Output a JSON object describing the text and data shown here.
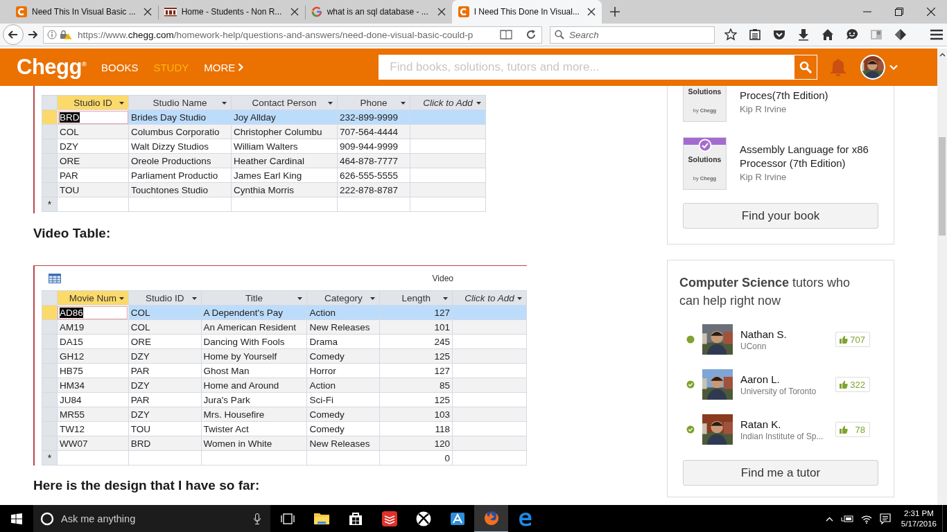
{
  "browser": {
    "tabs": [
      {
        "kind": "chegg",
        "title": "Need This In Visual Basic ...",
        "selected": false
      },
      {
        "kind": "iwu",
        "title": "Home - Students - Non R...",
        "selected": false
      },
      {
        "kind": "google",
        "title": "what is an sql database - ...",
        "selected": false
      },
      {
        "kind": "chegg",
        "title": "I Need This Done In Visual...",
        "selected": true
      }
    ],
    "url": {
      "scheme": "https://www.",
      "domain": "chegg.com",
      "path": "/homework-help/questions-and-answers/need-done-visual-basic-could-p"
    },
    "search": {
      "placeholder": "Search"
    }
  },
  "site_header": {
    "logo": "Chegg$^{®}$",
    "nav": [
      {
        "label": "BOOKS",
        "selected": false,
        "kind": "link"
      },
      {
        "label": "STUDY",
        "selected": true,
        "kind": "link"
      },
      {
        "label": "MORE",
        "selected": false,
        "kind": "menu"
      }
    ],
    "search": {
      "placeholder": "Find books, solutions, tutors and more..."
    }
  },
  "article": {
    "blocks": [
      {
        "kind": "table",
        "columns": [
          {
            "label": "Studio ID",
            "selected": true,
            "kind": "field"
          },
          {
            "label": "Studio Name",
            "selected": false,
            "kind": "field"
          },
          {
            "label": "Contact Person",
            "selected": false,
            "kind": "field"
          },
          {
            "label": "Phone",
            "selected": false,
            "kind": "field"
          },
          {
            "label": "Click to Add",
            "selected": false,
            "kind": "add"
          }
        ],
        "rows": [
          {
            "cells": [
              "BRD",
              "Brides Day Studio",
              "Joy Allday",
              "232-899-9999"
            ],
            "selected": true
          },
          {
            "cells": [
              "COL",
              "Columbus Corporatio",
              "Christopher Columbu",
              "707-564-4444"
            ],
            "selected": false
          },
          {
            "cells": [
              "DZY",
              "Walt Dizzy Studios",
              "William Walters",
              "909-944-9999"
            ],
            "selected": false
          },
          {
            "cells": [
              "ORE",
              "Oreole Productions",
              "Heather Cardinal",
              "464-878-7777"
            ],
            "selected": false
          },
          {
            "cells": [
              "PAR",
              "Parliament Productio",
              "James Earl King",
              "626-555-5555"
            ],
            "selected": false
          },
          {
            "cells": [
              "TOU",
              "Touchtones Studio",
              "Cynthia Morris",
              "222-878-8787"
            ],
            "selected": false
          },
          {
            "cells": [
              null,
              null,
              null,
              null
            ],
            "selected": false,
            "marker": "*"
          }
        ]
      },
      {
        "kind": "heading",
        "text": "Video Table:"
      },
      {
        "kind": "table",
        "caption": "Video",
        "columns": [
          {
            "label": "Movie Num",
            "selected": true,
            "kind": "field"
          },
          {
            "label": "Studio ID",
            "selected": false,
            "kind": "field"
          },
          {
            "label": "Title",
            "selected": false,
            "kind": "field"
          },
          {
            "label": "Category",
            "selected": false,
            "kind": "field"
          },
          {
            "label": "Length",
            "selected": false,
            "kind": "number"
          },
          {
            "label": "Click to Add",
            "selected": false,
            "kind": "add"
          }
        ],
        "rows": [
          {
            "cells": [
              "AD86",
              "COL",
              "A Dependent's Pay",
              "Action",
              "127"
            ],
            "selected": true
          },
          {
            "cells": [
              "AM19",
              "COL",
              "An American Resident",
              "New Releases",
              "101"
            ],
            "selected": false
          },
          {
            "cells": [
              "DA15",
              "ORE",
              "Dancing With Fools",
              "Drama",
              "245"
            ],
            "selected": false
          },
          {
            "cells": [
              "GH12",
              "DZY",
              "Home by Yourself",
              "Comedy",
              "125"
            ],
            "selected": false
          },
          {
            "cells": [
              "HB75",
              "PAR",
              "Ghost Man",
              "Horror",
              "127"
            ],
            "selected": false
          },
          {
            "cells": [
              "HM34",
              "DZY",
              "Home and Around",
              "Action",
              "85"
            ],
            "selected": false
          },
          {
            "cells": [
              "JU84",
              "PAR",
              "Jura's Park",
              "Sci-Fi",
              "125"
            ],
            "selected": false
          },
          {
            "cells": [
              "MR55",
              "DZY",
              "Mrs. Housefire",
              "Comedy",
              "103"
            ],
            "selected": false
          },
          {
            "cells": [
              "TW12",
              "TOU",
              "Twister Act",
              "Comedy",
              "118"
            ],
            "selected": false
          },
          {
            "cells": [
              "WW07",
              "BRD",
              "Women in White",
              "New Releases",
              "120"
            ],
            "selected": false
          },
          {
            "cells": [
              null,
              null,
              null,
              null,
              "0"
            ],
            "selected": false,
            "marker": "*"
          }
        ]
      },
      {
        "kind": "heading",
        "text": "Here is the design that I have so far:"
      }
    ]
  },
  "sidebar": {
    "books": [
      {
        "title": "Proces(7th Edition)",
        "author": "Kip R Irvine",
        "cover": {
          "label": "Solutions",
          "brand": "by **Chegg**"
        }
      },
      {
        "title": "Assembly Language for x86 Processor (7th Edition)",
        "author": "Kip R Irvine",
        "cover": {
          "label": "Solutions",
          "brand": "by **Chegg**",
          "checked": true
        }
      }
    ],
    "find_book_button": "Find your book",
    "tutors": {
      "heading": "**Computer Science** tutors who can help right now",
      "items": [
        {
          "name": "Nathan S.",
          "school": "UConn",
          "likes": "707",
          "kind": "dot"
        },
        {
          "name": "Aaron L.",
          "school": "University of Toronto",
          "likes": "322",
          "kind": "check"
        },
        {
          "name": "Ratan K.",
          "school": "Indian Institute of Sp...",
          "likes": "78",
          "kind": "check"
        }
      ],
      "button": "Find me a tutor"
    }
  },
  "taskbar": {
    "search": {
      "placeholder": "Ask me anything"
    },
    "apps": [
      {
        "kind": "explorer",
        "active": false
      },
      {
        "kind": "store",
        "active": false
      },
      {
        "kind": "todo",
        "active": false
      },
      {
        "kind": "xbox",
        "active": false
      },
      {
        "kind": "letter",
        "active": false
      },
      {
        "kind": "firefox",
        "active": true
      },
      {
        "kind": "edge",
        "active": false
      }
    ],
    "clock": {
      "time": "2:31 PM",
      "date": "5/17/2016"
    }
  }
}
